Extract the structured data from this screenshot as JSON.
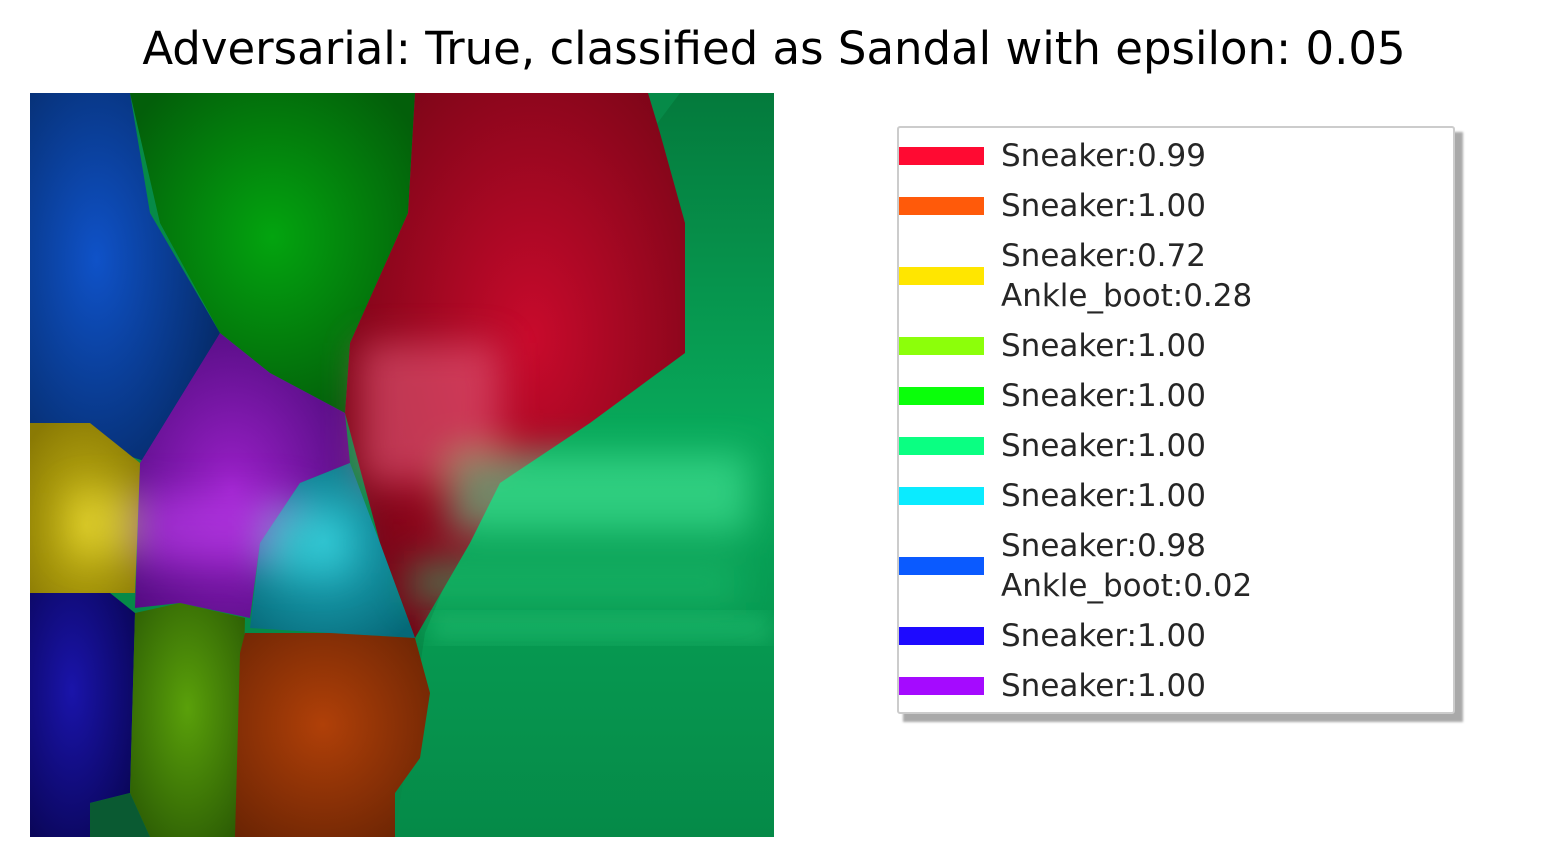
{
  "chart_data": {
    "type": "heatmap",
    "title": "Adversarial: True, classified as Sandal with epsilon: 0.05",
    "legend_placement": "right",
    "legend": [
      {
        "color": "#ff0a32",
        "lines": [
          "Sneaker:0.99"
        ]
      },
      {
        "color": "#ff5a0a",
        "lines": [
          "Sneaker:1.00"
        ]
      },
      {
        "color": "#ffe600",
        "lines": [
          "Sneaker:0.72",
          "Ankle_boot:0.28"
        ]
      },
      {
        "color": "#8cff0a",
        "lines": [
          "Sneaker:1.00"
        ]
      },
      {
        "color": "#0aff0a",
        "lines": [
          "Sneaker:1.00"
        ]
      },
      {
        "color": "#0aff82",
        "lines": [
          "Sneaker:1.00"
        ]
      },
      {
        "color": "#0aebff",
        "lines": [
          "Sneaker:1.00"
        ]
      },
      {
        "color": "#0a5aff",
        "lines": [
          "Sneaker:0.98",
          "Ankle_boot:0.02"
        ]
      },
      {
        "color": "#1e0aff",
        "lines": [
          "Sneaker:1.00"
        ]
      },
      {
        "color": "#a50aff",
        "lines": [
          "Sneaker:1.00"
        ]
      }
    ]
  }
}
